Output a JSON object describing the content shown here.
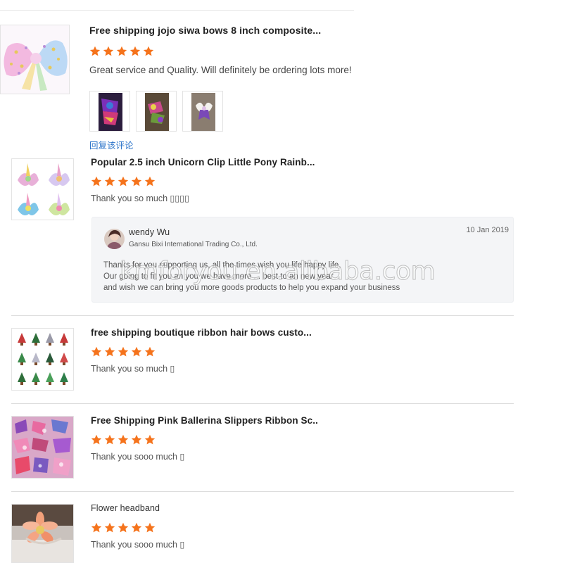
{
  "reviews": [
    {
      "title": "Free shipping jojo siwa bows 8 inch composite...",
      "comment": "Great service and Quality. Will definitely be ordering lots more!",
      "rating": 5,
      "reply_link": "回复该评论"
    },
    {
      "title": "Popular 2.5 inch Unicorn Clip Little Pony Rainb...",
      "comment": "Thank you so much ▯▯▯▯",
      "rating": 5
    },
    {
      "title": "free shipping boutique ribbon hair bows custo...",
      "comment": "Thank you so much ▯",
      "rating": 5
    },
    {
      "title": "Free Shipping Pink Ballerina Slippers Ribbon Sc..",
      "comment": "Thank you sooo much ▯",
      "rating": 5
    },
    {
      "title": "Flower headband",
      "comment": "Thank you sooo much ▯",
      "rating": 5
    }
  ],
  "seller_reply": {
    "name": "wendy Wu",
    "company": "Gansu Bixi International Trading Co., Ltd.",
    "date": "10 Jan 2019",
    "lines": [
      "Thanks for you supporting us, all the times wish you life happy life,",
      "Our going to fit you an you we have more ... best to an new year",
      "and wish we can bring you more goods products to help you expand your business"
    ]
  },
  "watermark": "kmforyou.en.alibaba.com",
  "colors": {
    "star": "#f5731c",
    "link": "#2a73c9",
    "reply_bg": "#f4f5f7"
  }
}
